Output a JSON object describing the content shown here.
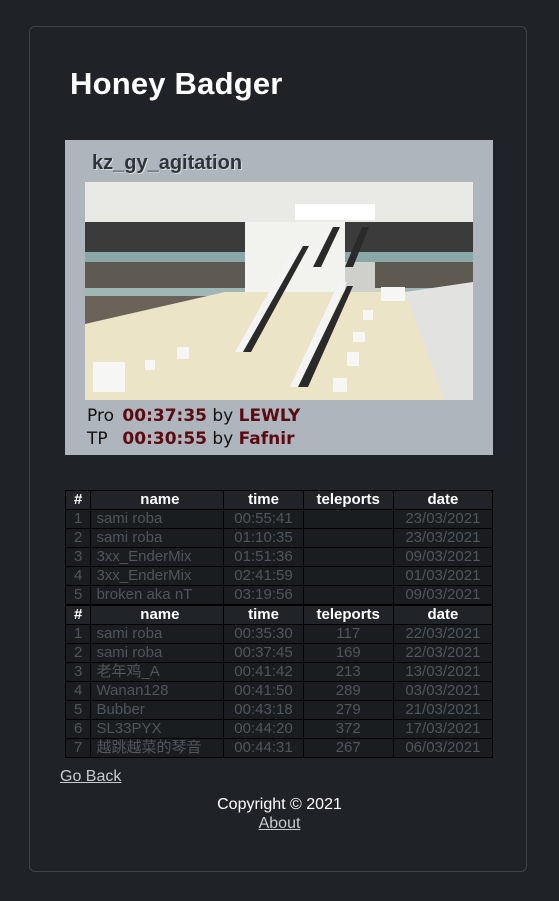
{
  "page": {
    "title": "Honey Badger"
  },
  "map": {
    "name": "kz_gy_agitation",
    "records": [
      {
        "label": "Pro",
        "time": "00:37:35",
        "by": "by",
        "player": "LEWLY"
      },
      {
        "label": "TP",
        "time": "00:30:55",
        "by": "by",
        "player": "Fafnir"
      }
    ]
  },
  "pro_table": {
    "headers": [
      "#",
      "name",
      "time",
      "teleports",
      "date"
    ],
    "rows": [
      [
        "1",
        "sami roba",
        "00:55:41",
        "",
        "23/03/2021"
      ],
      [
        "2",
        "sami roba",
        "01:10:35",
        "",
        "23/03/2021"
      ],
      [
        "3",
        "3xx_EnderMix",
        "01:51:36",
        "",
        "09/03/2021"
      ],
      [
        "4",
        "3xx_EnderMix",
        "02:41:59",
        "",
        "01/03/2021"
      ],
      [
        "5",
        "broken aka nT",
        "03:19:56",
        "",
        "09/03/2021"
      ]
    ]
  },
  "tp_table": {
    "headers": [
      "#",
      "name",
      "time",
      "teleports",
      "date"
    ],
    "rows": [
      [
        "1",
        "sami roba",
        "00:35:30",
        "117",
        "22/03/2021"
      ],
      [
        "2",
        "sami roba",
        "00:37:45",
        "169",
        "22/03/2021"
      ],
      [
        "3",
        "老年鸡_A",
        "00:41:42",
        "213",
        "13/03/2021"
      ],
      [
        "4",
        "Wanan128",
        "00:41:50",
        "289",
        "03/03/2021"
      ],
      [
        "5",
        "Bubber",
        "00:43:18",
        "279",
        "21/03/2021"
      ],
      [
        "6",
        "SL33PYX",
        "00:44:20",
        "372",
        "17/03/2021"
      ],
      [
        "7",
        "越跳越菜的琴音",
        "00:44:31",
        "267",
        "06/03/2021"
      ]
    ]
  },
  "nav": {
    "back": "Go Back"
  },
  "footer": {
    "copyright": "Copyright © 2021",
    "about": "About"
  }
}
